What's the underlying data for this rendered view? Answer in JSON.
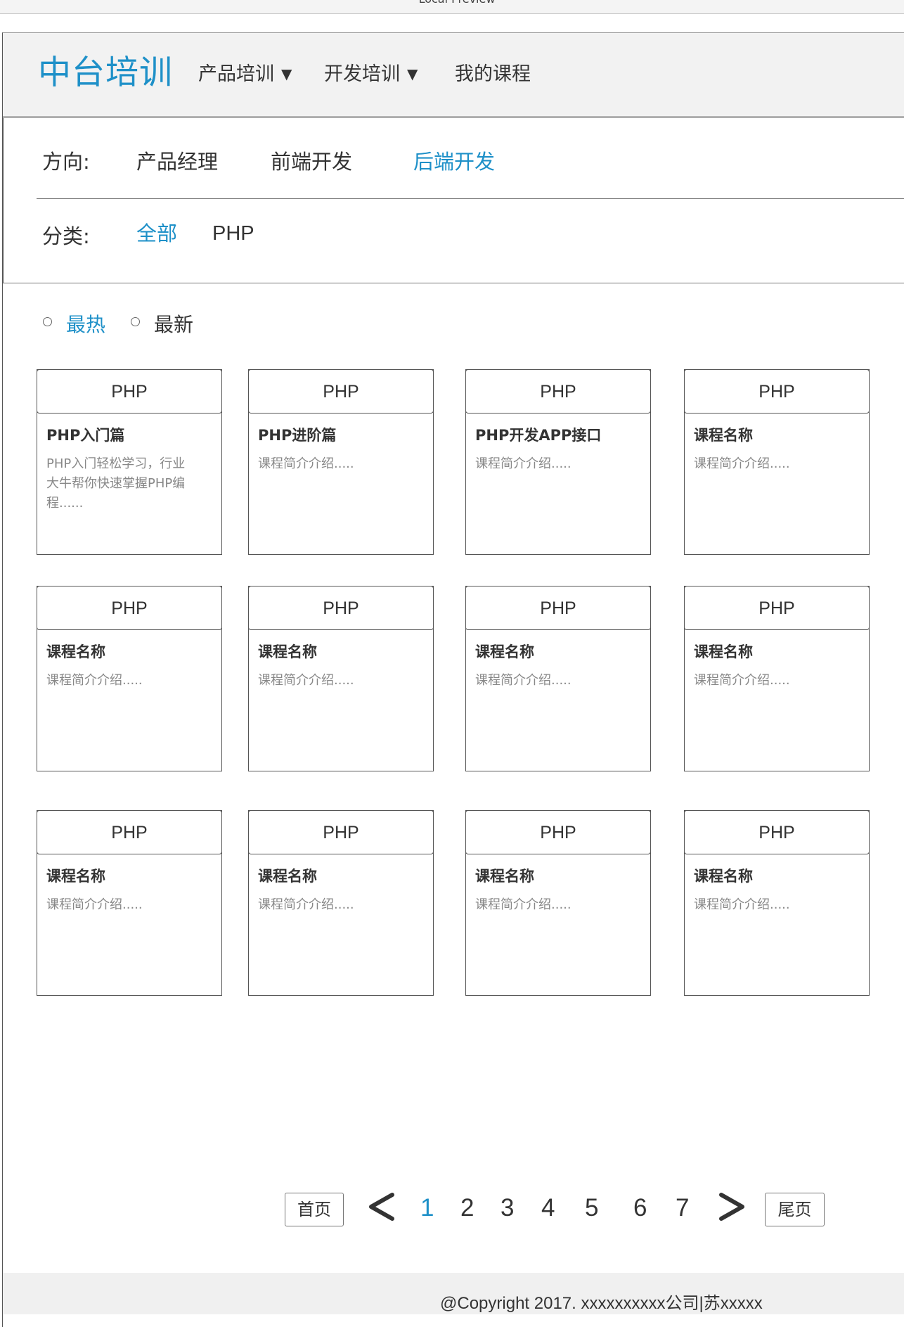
{
  "window": {
    "title": "Local Preview"
  },
  "header": {
    "logo": "中台培训",
    "nav": [
      {
        "label": "产品培训",
        "has_dropdown": true
      },
      {
        "label": "开发培训",
        "has_dropdown": true
      },
      {
        "label": "我的课程",
        "has_dropdown": false
      }
    ],
    "dropdown_arrow": "▼"
  },
  "filters": {
    "direction": {
      "label": "方向:",
      "options": [
        "产品经理",
        "前端开发",
        "后端开发"
      ],
      "selected": "后端开发"
    },
    "category": {
      "label": "分类:",
      "options": [
        "全部",
        "PHP"
      ],
      "selected": "全部"
    }
  },
  "sort": {
    "options": [
      "最热",
      "最新"
    ],
    "selected": "最热"
  },
  "courses": [
    {
      "tag": "PHP",
      "title": "PHP入门篇",
      "desc_lines": [
        "PHP入门轻松学习，行业",
        "大牛帮你快速掌握PHP编",
        "程......"
      ]
    },
    {
      "tag": "PHP",
      "title": "PHP进阶篇",
      "desc_lines": [
        "课程简介介绍....."
      ]
    },
    {
      "tag": "PHP",
      "title": "PHP开发APP接口",
      "desc_lines": [
        "课程简介介绍....."
      ]
    },
    {
      "tag": "PHP",
      "title": "课程名称",
      "desc_lines": [
        "课程简介介绍....."
      ]
    },
    {
      "tag": "PHP",
      "title": "课程名称",
      "desc_lines": [
        "课程简介介绍....."
      ]
    },
    {
      "tag": "PHP",
      "title": "课程名称",
      "desc_lines": [
        "课程简介介绍....."
      ]
    },
    {
      "tag": "PHP",
      "title": "课程名称",
      "desc_lines": [
        "课程简介介绍....."
      ]
    },
    {
      "tag": "PHP",
      "title": "课程名称",
      "desc_lines": [
        "课程简介介绍....."
      ]
    },
    {
      "tag": "PHP",
      "title": "课程名称",
      "desc_lines": [
        "课程简介介绍....."
      ]
    },
    {
      "tag": "PHP",
      "title": "课程名称",
      "desc_lines": [
        "课程简介介绍....."
      ]
    },
    {
      "tag": "PHP",
      "title": "课程名称",
      "desc_lines": [
        "课程简介介绍....."
      ]
    },
    {
      "tag": "PHP",
      "title": "课程名称",
      "desc_lines": [
        "课程简介介绍....."
      ]
    }
  ],
  "pagination": {
    "first_label": "首页",
    "last_label": "尾页",
    "pages": [
      "1",
      "2",
      "3",
      "4",
      "5",
      "6",
      "7"
    ],
    "current": "1"
  },
  "footer": {
    "copyright": "@Copyright 2017. xxxxxxxxxx公司|苏xxxxx"
  },
  "colors": {
    "accent": "#1e90c8",
    "text": "#333333",
    "muted": "#888888",
    "header_bg": "#f2f2f2",
    "border": "#555555"
  }
}
